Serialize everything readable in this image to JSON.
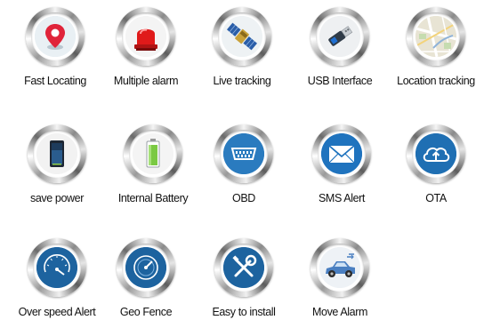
{
  "features": [
    {
      "label": "Fast Locating",
      "icon": "map-pin-icon"
    },
    {
      "label": "Multiple alarm",
      "icon": "siren-icon"
    },
    {
      "label": "Live tracking",
      "icon": "satellite-icon"
    },
    {
      "label": "USB Interface",
      "icon": "usb-drive-icon"
    },
    {
      "label": "Location tracking",
      "icon": "map-icon"
    },
    {
      "label": "save power",
      "icon": "battery-dark-icon"
    },
    {
      "label": "Internal Battery",
      "icon": "battery-green-icon"
    },
    {
      "label": "OBD",
      "icon": "obd-connector-icon"
    },
    {
      "label": "SMS Alert",
      "icon": "envelope-icon"
    },
    {
      "label": "OTA",
      "icon": "cloud-upload-icon"
    },
    {
      "label": "Over speed Alert",
      "icon": "speedometer-icon"
    },
    {
      "label": "Geo Fence",
      "icon": "gauge-icon"
    },
    {
      "label": "Easy to install",
      "icon": "tools-icon"
    },
    {
      "label": "Move Alarm",
      "icon": "car-icon"
    }
  ]
}
